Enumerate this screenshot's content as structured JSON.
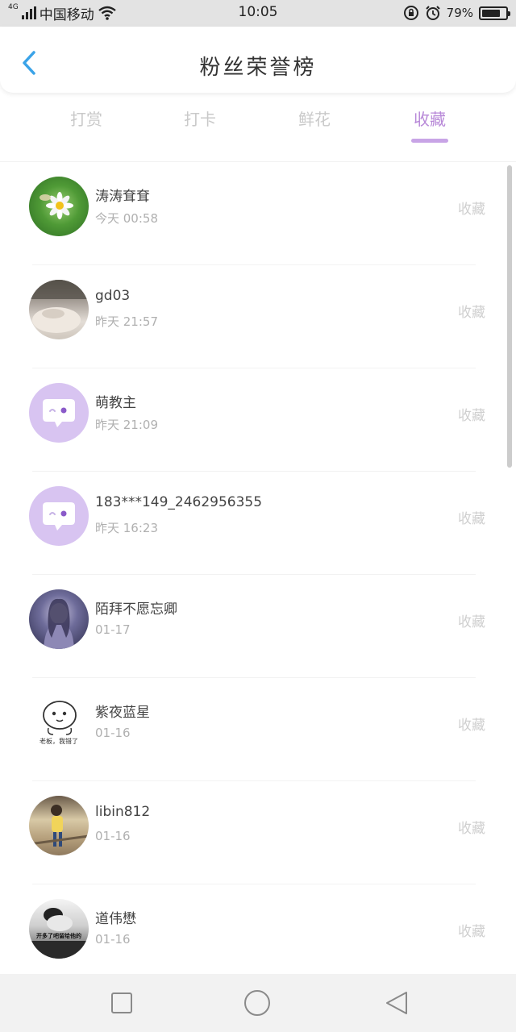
{
  "status_bar": {
    "network_type": "4G",
    "carrier": "中国移动",
    "time": "10:05",
    "battery_percent_text": "79%",
    "battery_level": 0.79,
    "icons": [
      "signal-icon",
      "wifi-icon",
      "rotation-lock-icon",
      "alarm-icon",
      "battery-icon"
    ]
  },
  "header": {
    "title": "粉丝荣誉榜",
    "back_icon": "chevron-left-icon"
  },
  "tabs": [
    {
      "label": "打赏",
      "active": false
    },
    {
      "label": "打卡",
      "active": false
    },
    {
      "label": "鲜花",
      "active": false
    },
    {
      "label": "收藏",
      "active": true
    }
  ],
  "list": {
    "items": [
      {
        "name": "涛涛耷耷",
        "time": "今天 00:58",
        "action": "收藏",
        "avatar": "daisy-photo-avatar"
      },
      {
        "name": "gd03",
        "time": "昨天 21:57",
        "action": "收藏",
        "avatar": "face-photo-avatar"
      },
      {
        "name": "萌教主",
        "time": "昨天 21:09",
        "action": "收藏",
        "avatar": "default-chat-bubble-avatar"
      },
      {
        "name": "183***149_2462956355",
        "time": "昨天 16:23",
        "action": "收藏",
        "avatar": "default-chat-bubble-avatar"
      },
      {
        "name": "陌拜不愿忘卿",
        "time": "01-17",
        "action": "收藏",
        "avatar": "fantasy-girl-avatar"
      },
      {
        "name": "紫夜蓝星",
        "time": "01-16",
        "action": "收藏",
        "avatar": "cartoon-sticker-avatar"
      },
      {
        "name": "libin812",
        "time": "01-16",
        "action": "收藏",
        "avatar": "boy-photo-avatar"
      },
      {
        "name": "道伟懋",
        "time": "01-16",
        "action": "收藏",
        "avatar": "monochrome-photo-avatar"
      }
    ],
    "sticker_caption": "老板，我错了",
    "bw_caption": "开多了吧留给他的"
  },
  "colors": {
    "accent": "#b889d8",
    "indicator": "#c8a4e6",
    "back_arrow": "#3aa3e8",
    "inactive_tab": "#c9c9c9",
    "avatar_bubble_bg": "#d8c4f1"
  },
  "nav_bar": {
    "buttons": [
      "recent-apps-square-icon",
      "home-circle-icon",
      "back-triangle-icon"
    ]
  }
}
